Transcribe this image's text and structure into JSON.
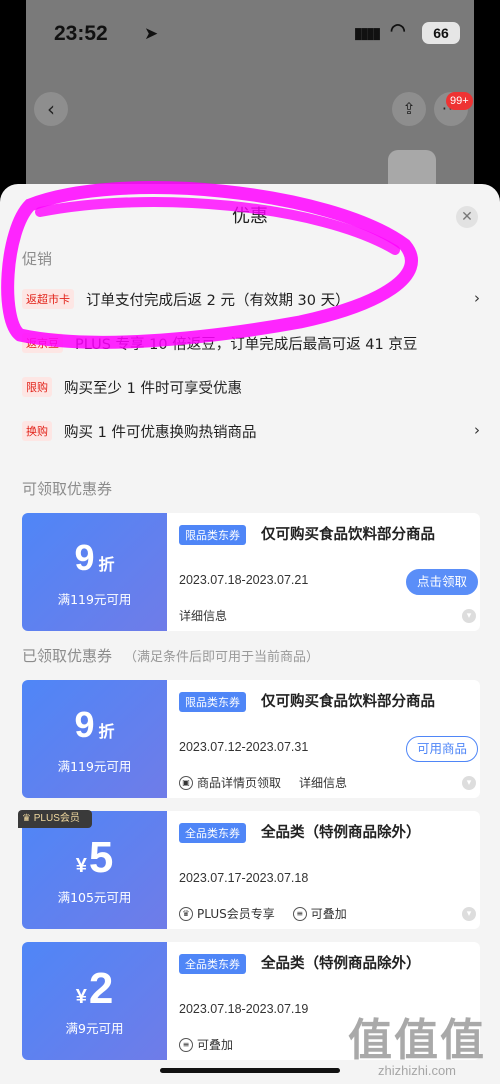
{
  "status_bar": {
    "time": "23:52",
    "location_glyph": "➤",
    "signal": "▮▮▮▮",
    "wifi": "◠",
    "battery": "66"
  },
  "nav": {
    "back_glyph": "‹",
    "share_glyph": "⇪",
    "more_glyph": "···",
    "badge": "99+"
  },
  "sheet": {
    "title": "优惠",
    "close_glyph": "✕"
  },
  "promo": {
    "section_title": "促销",
    "items": [
      {
        "tag": "返超市卡",
        "text": "订单支付完成后返 2 元（有效期 30 天）",
        "arrow": "›"
      },
      {
        "tag": "返京豆",
        "text": "PLUS 专享 10 倍返豆，订单完成后最高可返 41 京豆",
        "arrow": ""
      },
      {
        "tag": "限购",
        "text": "购买至少 1 件时可享受优惠",
        "arrow": ""
      },
      {
        "tag": "换购",
        "text": "购买 1 件可优惠换购热销商品",
        "arrow": "›"
      }
    ]
  },
  "claimable": {
    "section_title": "可领取优惠券",
    "coupons": [
      {
        "amount": "9",
        "unit": "折",
        "condition": "满119元可用",
        "type": "限品类东券",
        "title": "仅可购买食品饮料部分商品",
        "date": "2023.07.18-2023.07.21",
        "button": "点击领取",
        "foot1": "详细信息"
      }
    ]
  },
  "claimed": {
    "section_title": "已领取优惠券",
    "section_sub": "（满足条件后即可用于当前商品）",
    "coupons": [
      {
        "amount": "9",
        "unit": "折",
        "condition": "满119元可用",
        "type": "限品类东券",
        "title": "仅可购买食品饮料部分商品",
        "date": "2023.07.12-2023.07.31",
        "button": "可用商品",
        "foot1": "商品详情页领取",
        "foot2": "详细信息"
      },
      {
        "plus_badge": "PLUS会员",
        "yen": "¥",
        "amount": "5",
        "condition": "满105元可用",
        "type": "全品类东券",
        "title": "全品类（特例商品除外）",
        "date": "2023.07.17-2023.07.18",
        "foot1": "PLUS会员专享",
        "foot2": "可叠加"
      },
      {
        "yen": "¥",
        "amount": "2",
        "condition": "满9元可用",
        "type": "全品类东券",
        "title": "全品类（特例商品除外）",
        "date": "2023.07.18-2023.07.19",
        "foot1": "可叠加"
      }
    ]
  },
  "watermark": {
    "big": "值值值",
    "domain": "zhizhizhi.com"
  },
  "colors": {
    "accent": "#4f86f7",
    "promo_red": "#e2231a",
    "highlight": "#ff00ff"
  }
}
